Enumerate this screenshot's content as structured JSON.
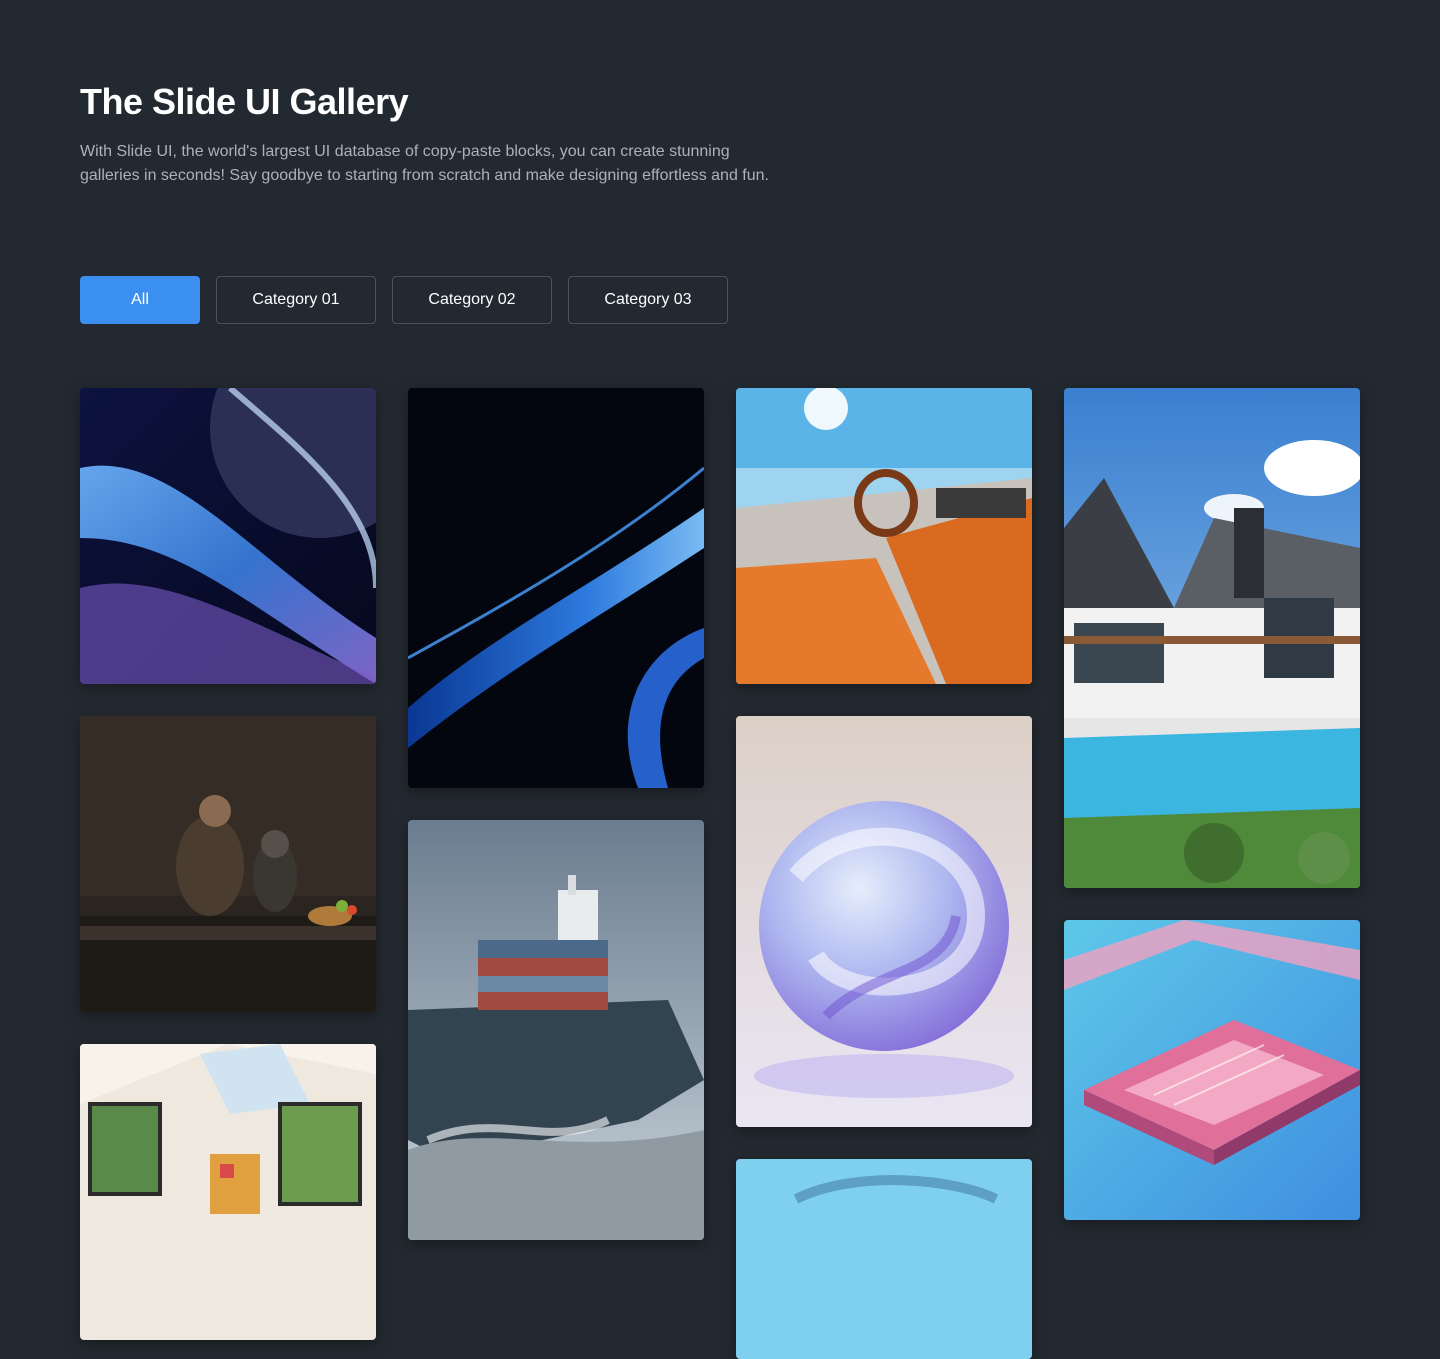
{
  "header": {
    "title": "The Slide UI Gallery",
    "description": "With Slide UI, the world's largest UI database of copy-paste blocks, you can create stunning galleries in seconds! Say goodbye to starting from scratch and make designing effortless and fun."
  },
  "filters": [
    {
      "label": "All",
      "active": true
    },
    {
      "label": "Category 01",
      "active": false
    },
    {
      "label": "Category 02",
      "active": false
    },
    {
      "label": "Category 03",
      "active": false
    }
  ],
  "colors": {
    "background": "#232930",
    "accent": "#3b8ff0",
    "text_muted": "#aab2bd",
    "button_border": "#4a515a"
  },
  "gallery": {
    "images": [
      {
        "name": "abstract-blue-wave-image",
        "subject": "blue abstract wave"
      },
      {
        "name": "man-with-dog-image",
        "subject": "man and dog in dark room"
      },
      {
        "name": "bright-studio-interior-image",
        "subject": "bright interior with skylight"
      },
      {
        "name": "blue-light-swirl-image",
        "subject": "blue light swirl on black"
      },
      {
        "name": "cargo-ship-image",
        "subject": "container ship at sea"
      },
      {
        "name": "car-interior-image",
        "subject": "orange car interior"
      },
      {
        "name": "glass-sphere-image",
        "subject": "glass sphere"
      },
      {
        "name": "glass-object-partial-image",
        "subject": "glass object"
      },
      {
        "name": "modern-house-pool-image",
        "subject": "modern house with pool"
      },
      {
        "name": "circuit-chip-image",
        "subject": "pink and blue circuit chip"
      }
    ]
  }
}
